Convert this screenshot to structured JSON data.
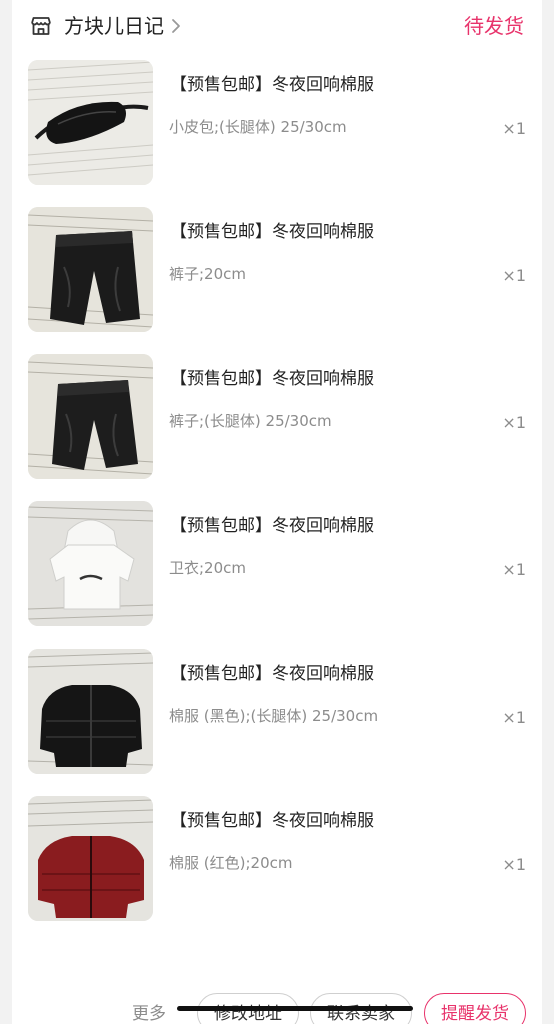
{
  "header": {
    "shop_name": "方块儿日记",
    "shop_icon": "store-icon",
    "chevron_icon": "chevron-right-icon",
    "status": "待发货"
  },
  "items": [
    {
      "title": "【预售包邮】冬夜回响棉服",
      "spec": "小皮包;(长腿体) 25/30cm",
      "qty": "×1",
      "image": "black-waist-bag"
    },
    {
      "title": "【预售包邮】冬夜回响棉服",
      "spec": "裤子;20cm",
      "qty": "×1",
      "image": "black-pants"
    },
    {
      "title": "【预售包邮】冬夜回响棉服",
      "spec": "裤子;(长腿体) 25/30cm",
      "qty": "×1",
      "image": "black-pants"
    },
    {
      "title": "【预售包邮】冬夜回响棉服",
      "spec": "卫衣;20cm",
      "qty": "×1",
      "image": "white-hoodie"
    },
    {
      "title": "【预售包邮】冬夜回响棉服",
      "spec": "棉服 (黑色);(长腿体) 25/30cm",
      "qty": "×1",
      "image": "black-puffer-jacket"
    },
    {
      "title": "【预售包邮】冬夜回响棉服",
      "spec": "棉服 (红色);20cm",
      "qty": "×1",
      "image": "red-puffer-jacket"
    }
  ],
  "footer": {
    "more_label": "更多",
    "change_address_label": "修改地址",
    "contact_seller_label": "联系卖家",
    "remind_ship_label": "提醒发货"
  },
  "colors": {
    "accent": "#e8336b",
    "text_primary": "#222222",
    "text_secondary": "#8c8c8c",
    "background": "#f2f2f2"
  }
}
